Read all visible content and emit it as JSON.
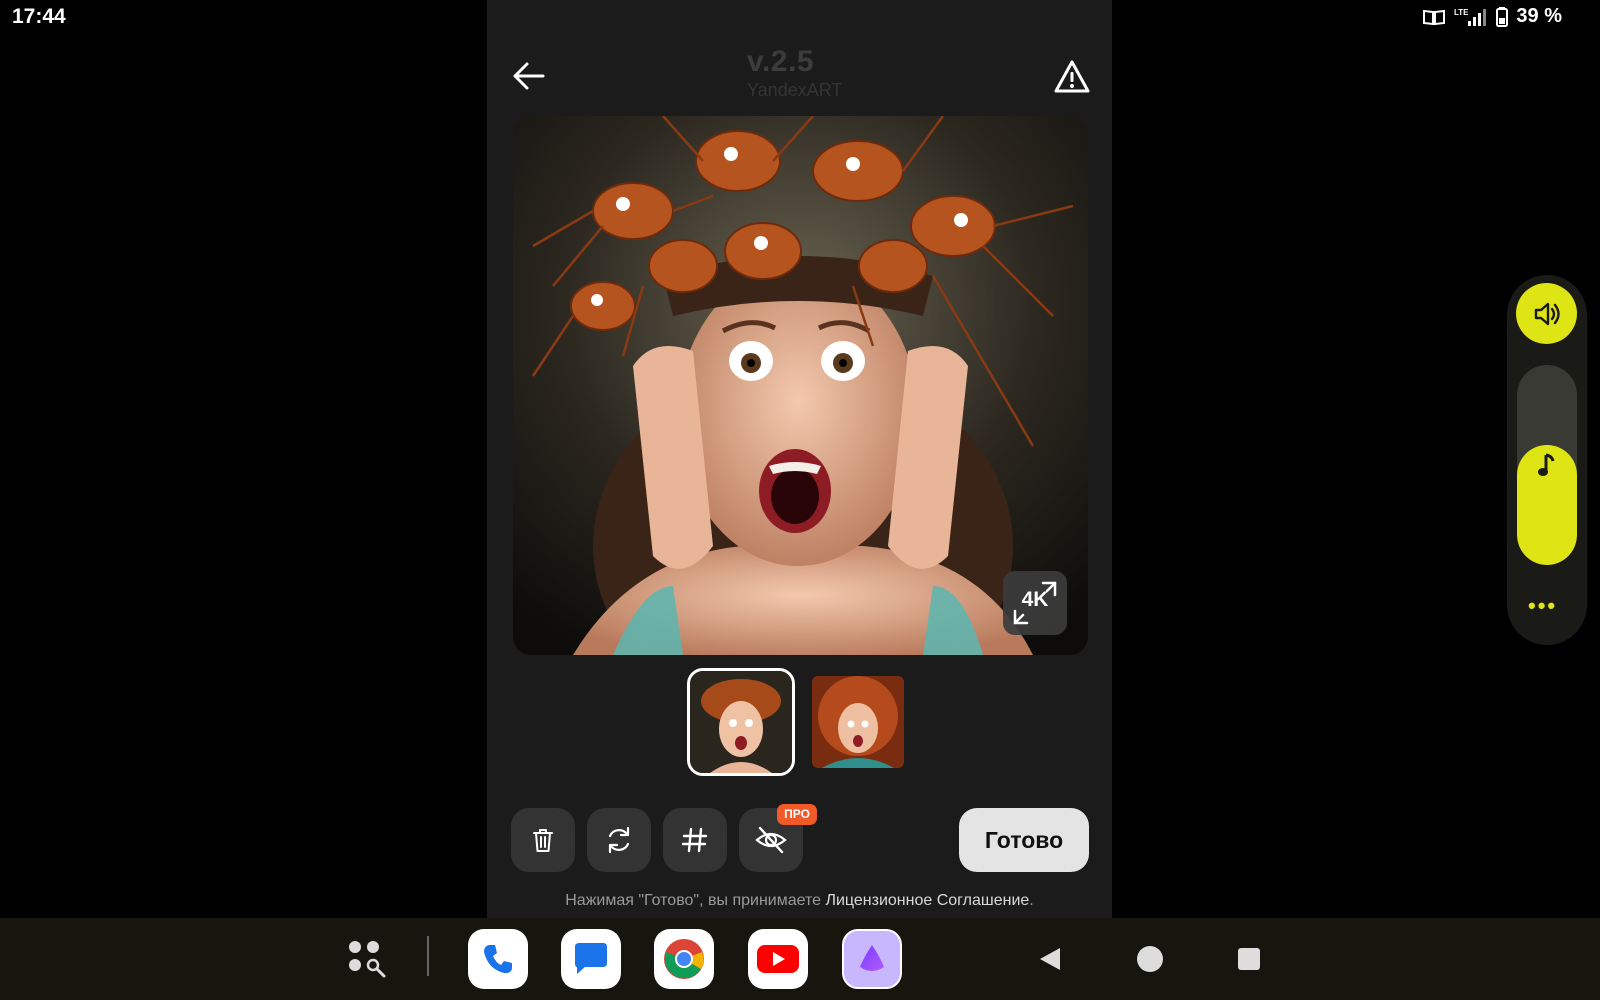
{
  "status_bar": {
    "time": "17:44",
    "battery": "39 %",
    "network": "LTE"
  },
  "header": {
    "version": "v.2.5",
    "subtitle": "YandexART"
  },
  "image": {
    "badge": "4K"
  },
  "toolbar": {
    "pro_label": "ПРО",
    "done_label": "Готово"
  },
  "footer": {
    "prefix": "Нажимая \"Готово\", вы принимаете ",
    "link": "Лицензионное Соглашение",
    "suffix": "."
  },
  "volume": {
    "level": 0.6
  },
  "colors": {
    "accent": "#DFE414",
    "pro": "#F05A28",
    "panel": "#1B1B1B"
  },
  "dock": {
    "apps": [
      "phone-icon",
      "messages-icon",
      "chrome-icon",
      "youtube-icon",
      "alice-icon"
    ]
  }
}
